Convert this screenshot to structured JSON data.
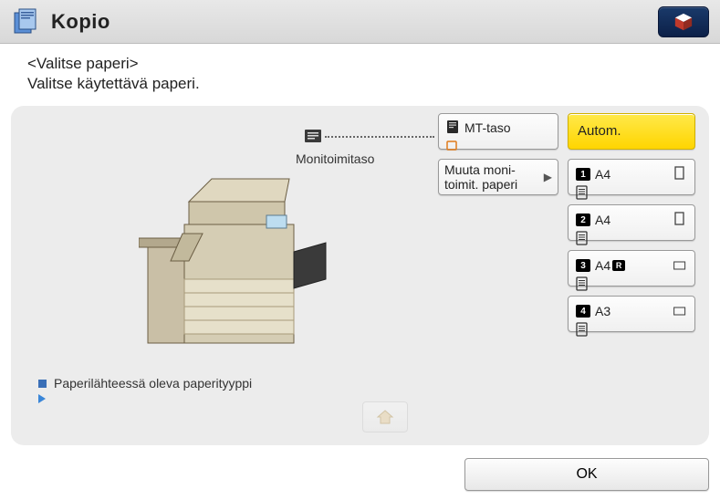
{
  "header": {
    "title": "Kopio"
  },
  "subtitle": {
    "line1": "<Valitse paperi>",
    "line2": "Valitse käytettävä paperi."
  },
  "mt": {
    "label": "Monitoimitaso",
    "button_label": "MT-taso"
  },
  "muuta": {
    "label": "Muuta moni-\ntoimit. paperi"
  },
  "trays": {
    "autom": {
      "label": "Autom.",
      "selected": true
    },
    "list": [
      {
        "num": "1",
        "size": "A4",
        "r": false,
        "orient": "portrait"
      },
      {
        "num": "2",
        "size": "A4",
        "r": false,
        "orient": "portrait"
      },
      {
        "num": "3",
        "size": "A4",
        "r": true,
        "orient": "landscape"
      },
      {
        "num": "4",
        "size": "A3",
        "r": false,
        "orient": "landscape"
      }
    ]
  },
  "legend": {
    "line1": "Paperilähteessä oleva paperityyppi"
  },
  "ok": {
    "label": "OK"
  }
}
